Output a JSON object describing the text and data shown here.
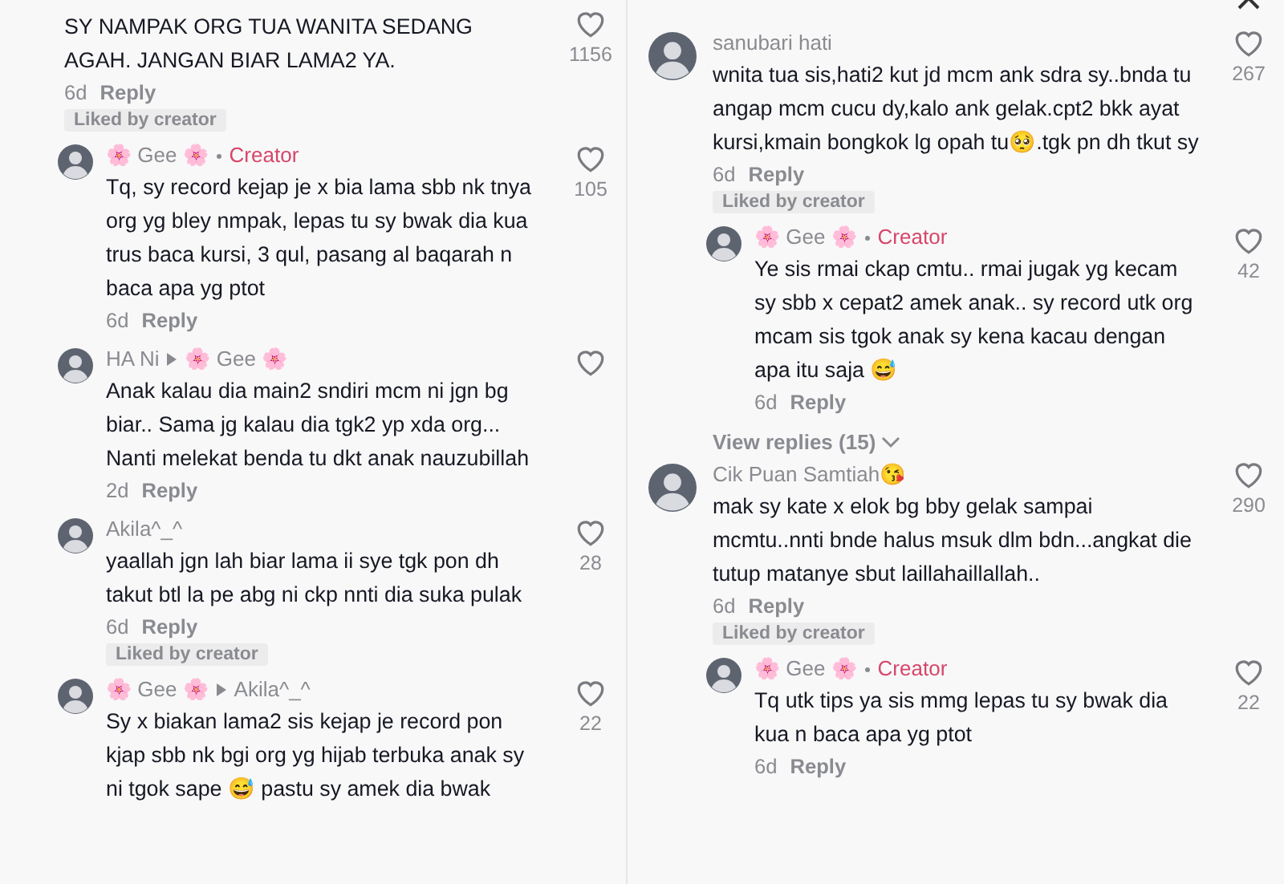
{
  "panels": [
    {
      "comments": [
        {
          "kind": "comment",
          "text": "SY NAMPAK ORG TUA WANITA SEDANG AGAH. JANGAN BIAR LAMA2 YA.",
          "time": "6d",
          "reply": "Reply",
          "likes": "1156",
          "liked_by_creator": true,
          "liked_label": "Liked by creator",
          "children": [
            {
              "kind": "reply",
              "author": "🌸 Gee 🌸",
              "creator": true,
              "creator_label": "Creator",
              "text": "Tq, sy record kejap je x bia lama sbb nk tnya org yg bley nmpak, lepas tu sy bwak dia kua trus baca kursi, 3 qul, pasang al baqarah n baca apa yg ptot",
              "time": "6d",
              "reply": "Reply",
              "likes": "105"
            },
            {
              "kind": "reply",
              "author": "HA Ni",
              "reply_to": "🌸 Gee 🌸",
              "text": "Anak kalau dia main2 sndiri mcm ni jgn bg biar.. Sama jg kalau dia tgk2 yp xda org... Nanti melekat benda tu dkt anak nauzubillah",
              "time": "2d",
              "reply": "Reply"
            },
            {
              "kind": "reply",
              "author": "Akila^_^",
              "text": "yaallah jgn lah biar lama ii sye tgk pon dh takut btl la pe abg ni ckp nnti dia suka pulak",
              "time": "6d",
              "reply": "Reply",
              "likes": "28",
              "liked_by_creator": true,
              "liked_label": "Liked by creator"
            },
            {
              "kind": "reply",
              "author": "🌸 Gee 🌸",
              "reply_to": "Akila^_^",
              "text": "Sy x biakan lama2 sis kejap je record pon kjap sbb nk bgi org yg hijab terbuka anak sy ni tgok sape 😅 pastu sy amek dia bwak",
              "likes": "22"
            }
          ]
        }
      ]
    },
    {
      "close_button": true,
      "comments": [
        {
          "kind": "comment",
          "author": "sanubari hati",
          "text": "wnita tua sis,hati2 kut jd mcm ank sdra sy..bnda tu angap mcm cucu dy,kalo ank gelak.cpt2 bkk ayat kursi,kmain bongkok lg opah tu🥺.tgk pn dh tkut sy",
          "time": "6d",
          "reply": "Reply",
          "likes": "267",
          "liked_by_creator": true,
          "liked_label": "Liked by creator",
          "view_replies": "View replies (15)",
          "children": [
            {
              "kind": "reply",
              "author": "🌸 Gee 🌸",
              "creator": true,
              "creator_label": "Creator",
              "text": "Ye sis rmai ckap cmtu.. rmai jugak yg kecam sy sbb x cepat2 amek anak.. sy record utk org mcam sis tgok anak sy kena kacau dengan apa itu saja 😅",
              "time": "6d",
              "reply": "Reply",
              "likes": "42"
            }
          ]
        },
        {
          "kind": "comment",
          "author": "Cik Puan Samtiah😘",
          "text": "mak sy kate x elok bg bby gelak sampai mcmtu..nnti bnde halus msuk dlm bdn...angkat die tutup matanye sbut laillahaillallah..",
          "time": "6d",
          "reply": "Reply",
          "likes": "290",
          "liked_by_creator": true,
          "liked_label": "Liked by creator",
          "children": [
            {
              "kind": "reply",
              "author": "🌸 Gee 🌸",
              "creator": true,
              "creator_label": "Creator",
              "text": "Tq utk tips ya sis mmg lepas tu sy bwak dia kua n baca apa yg ptot",
              "time": "6d",
              "reply": "Reply",
              "likes": "22"
            }
          ]
        }
      ]
    }
  ]
}
